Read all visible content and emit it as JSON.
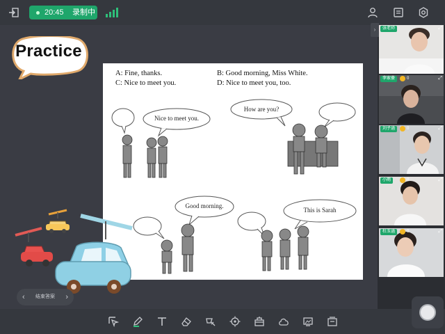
{
  "topbar": {
    "timer": "20:45",
    "recording_status": "录制中"
  },
  "board": {
    "title": "Practice",
    "options": {
      "a": "A: Fine, thanks.",
      "b": "B: Good morning, Miss White.",
      "c": "C: Nice to meet you.",
      "d": "D: Nice to meet you, too."
    },
    "speech": {
      "panel1": "Nice to meet you.",
      "panel2": "How are you?",
      "panel3": "Good morning.",
      "panel4": "This is Sarah"
    },
    "page_nav_label": "结束答案"
  },
  "videos": [
    {
      "name": "张老师",
      "count": ""
    },
    {
      "name": "李家豪",
      "count": "0"
    },
    {
      "name": "刘子涵",
      "count": "0"
    },
    {
      "name": "小雨",
      "count": "0"
    },
    {
      "name": "杜玉涵",
      "count": "0"
    }
  ],
  "colors": {
    "accent": "#1fa66b",
    "background": "#2f3136",
    "board": "#3a3c44"
  }
}
